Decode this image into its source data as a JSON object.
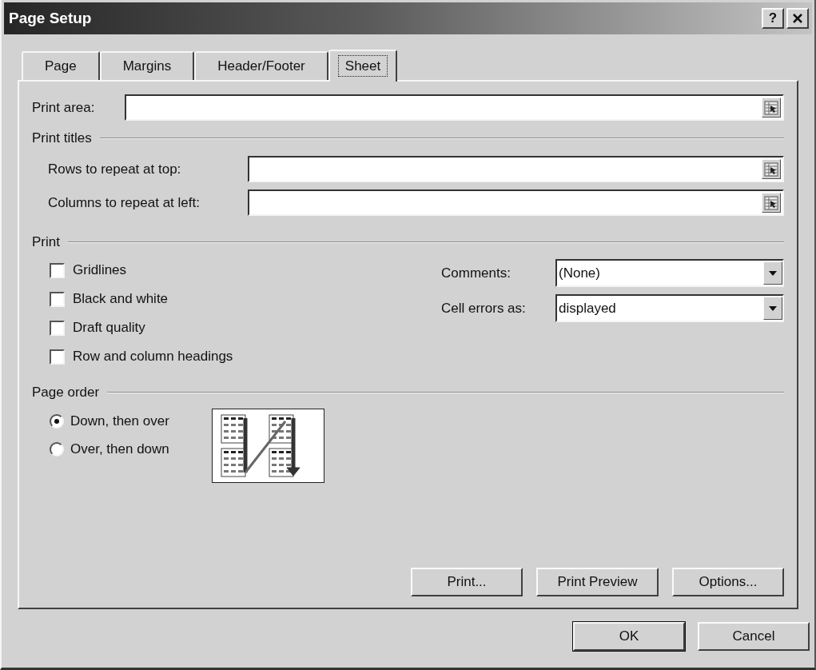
{
  "window": {
    "title": "Page Setup",
    "help": "?"
  },
  "tabs": [
    {
      "label": "Page",
      "selected": false
    },
    {
      "label": "Margins",
      "selected": false
    },
    {
      "label": "Header/Footer",
      "selected": false
    },
    {
      "label": "Sheet",
      "selected": true
    }
  ],
  "print_area": {
    "label": "Print area:"
  },
  "print_titles": {
    "heading": "Print titles",
    "fields": [
      {
        "label": "Rows to repeat at top:"
      },
      {
        "label": "Columns to repeat at left:"
      }
    ]
  },
  "print": {
    "heading": "Print",
    "checkboxes": [
      {
        "label": "Gridlines",
        "checked": false
      },
      {
        "label": "Black and white",
        "checked": false
      },
      {
        "label": "Draft quality",
        "checked": false
      },
      {
        "label": "Row and column headings",
        "checked": false
      }
    ],
    "dropdowns": [
      {
        "label": "Comments:",
        "value": "(None)"
      },
      {
        "label": "Cell errors as:",
        "value": "displayed"
      }
    ]
  },
  "page_order": {
    "heading": "Page order",
    "options": [
      {
        "label": "Down, then over",
        "selected": true
      },
      {
        "label": "Over, then down",
        "selected": false
      }
    ]
  },
  "panel_buttons": [
    "Print...",
    "Print Preview",
    "Options..."
  ],
  "footer_buttons": [
    {
      "label": "OK",
      "default": true
    },
    {
      "label": "Cancel",
      "default": false
    }
  ]
}
